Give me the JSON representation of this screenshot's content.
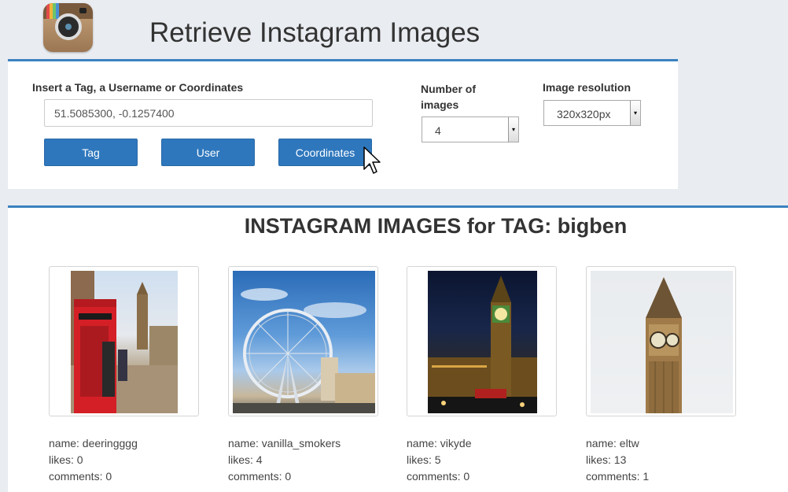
{
  "header": {
    "title": "Retrieve Instagram Images"
  },
  "form": {
    "query_label": "Insert a Tag, a Username or Coordinates",
    "query_value": "51.5085300, -0.1257400",
    "buttons": {
      "tag": "Tag",
      "user": "User",
      "coordinates": "Coordinates"
    },
    "number_label": "Number of images",
    "number_value": "4",
    "resolution_label": "Image resolution",
    "resolution_value": "320x320px"
  },
  "results": {
    "title": "INSTAGRAM IMAGES for TAG: bigben",
    "items": [
      {
        "name": "name: deeringggg",
        "likes": "likes: 0",
        "comments": "comments: 0"
      },
      {
        "name": "name: vanilla_smokers",
        "likes": "likes: 4",
        "comments": "comments: 0"
      },
      {
        "name": "name: vikyde",
        "likes": "likes: 5",
        "comments": "comments: 0"
      },
      {
        "name": "name: eltw",
        "likes": "likes: 13",
        "comments": "comments: 1"
      }
    ]
  },
  "colors": {
    "accent": "#3b82c0",
    "button": "#2e77bd",
    "page_bg": "#e9ecf1"
  },
  "icons": {
    "logo": "instagram-logo-icon",
    "cursor": "mouse-pointer-icon",
    "dropdown": "chevron-down-icon"
  }
}
